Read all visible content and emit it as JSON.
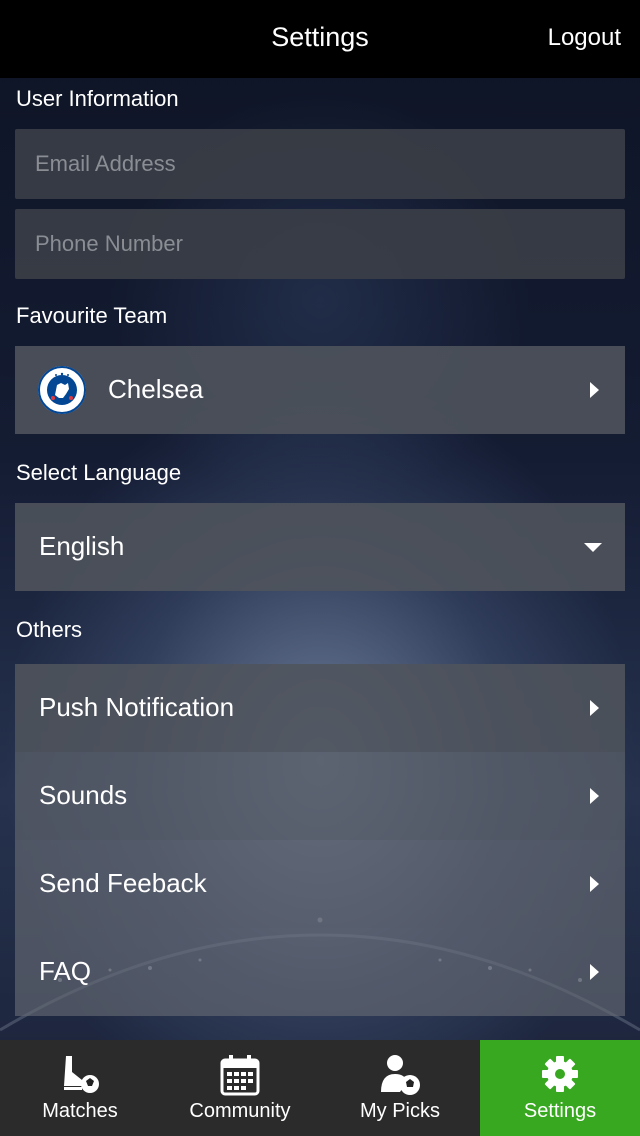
{
  "header": {
    "title": "Settings",
    "logout_label": "Logout"
  },
  "user_info": {
    "section_label": "User Information",
    "email_placeholder": "Email Address",
    "email_value": "",
    "phone_placeholder": "Phone Number",
    "phone_value": ""
  },
  "favourite_team": {
    "section_label": "Favourite Team",
    "team_name": "Chelsea",
    "crest_text": "CHELSEA FOOTBALL CLUB",
    "crest_icon": "chelsea-crest-icon"
  },
  "language": {
    "section_label": "Select Language",
    "selected": "English"
  },
  "others": {
    "section_label": "Others",
    "items": [
      {
        "label": "Push Notification"
      },
      {
        "label": "Sounds"
      },
      {
        "label": "Send Feeback"
      },
      {
        "label": "FAQ"
      }
    ]
  },
  "tabbar": {
    "tabs": [
      {
        "label": "Matches",
        "icon": "boot-ball-icon",
        "active": false
      },
      {
        "label": "Community",
        "icon": "calendar-icon",
        "active": false
      },
      {
        "label": "My Picks",
        "icon": "person-ball-icon",
        "active": false
      },
      {
        "label": "Settings",
        "icon": "gear-icon",
        "active": true
      }
    ]
  },
  "colors": {
    "header_bg": "#000000",
    "active_tab": "#37a81f",
    "tabbar_bg": "#2b2b2b",
    "crest_blue": "#034694"
  }
}
